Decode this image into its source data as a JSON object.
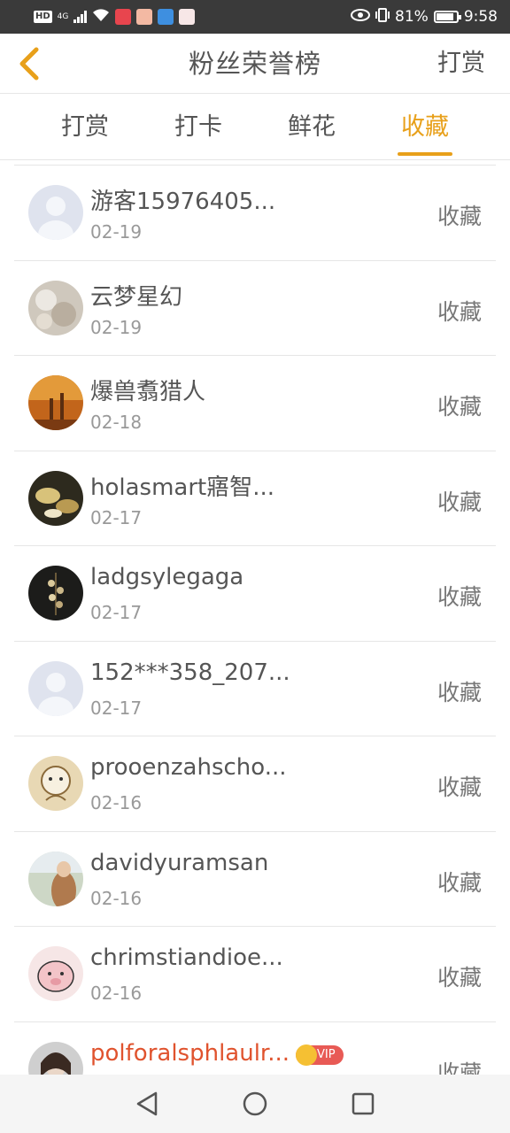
{
  "status_bar": {
    "hd": "HD",
    "network": "4G",
    "battery_percent": "81%",
    "time": "9:58"
  },
  "header": {
    "title": "粉丝荣誉榜",
    "action_label": "打赏"
  },
  "tabs": [
    {
      "label": "打赏",
      "active": false
    },
    {
      "label": "打卡",
      "active": false
    },
    {
      "label": "鲜花",
      "active": false
    },
    {
      "label": "收藏",
      "active": true
    }
  ],
  "colors": {
    "accent": "#e8a01a",
    "vip_name": "#e0532e"
  },
  "list": [
    {
      "name": "游客15976405...",
      "date": "02-19",
      "action": "收藏",
      "avatar": "default-avatar"
    },
    {
      "name": "云梦星幻",
      "date": "02-19",
      "action": "收藏",
      "avatar": "photo-avatar"
    },
    {
      "name": "爆兽翥猎人",
      "date": "02-18",
      "action": "收藏",
      "avatar": "photo-avatar"
    },
    {
      "name": "holasmart寤智...",
      "date": "02-17",
      "action": "收藏",
      "avatar": "photo-avatar"
    },
    {
      "name": "ladgsylegaga",
      "date": "02-17",
      "action": "收藏",
      "avatar": "photo-avatar"
    },
    {
      "name": "152***358_207...",
      "date": "02-17",
      "action": "收藏",
      "avatar": "default-avatar"
    },
    {
      "name": "prooenzahscho...",
      "date": "02-16",
      "action": "收藏",
      "avatar": "illustration-avatar"
    },
    {
      "name": "davidyuramsan",
      "date": "02-16",
      "action": "收藏",
      "avatar": "photo-avatar"
    },
    {
      "name": "chrimstiandioe...",
      "date": "02-16",
      "action": "收藏",
      "avatar": "illustration-avatar"
    },
    {
      "name": "polforalsphlaulr...",
      "date": "",
      "action": "收藏",
      "avatar": "photo-avatar",
      "vip_badge": "VIP"
    }
  ]
}
